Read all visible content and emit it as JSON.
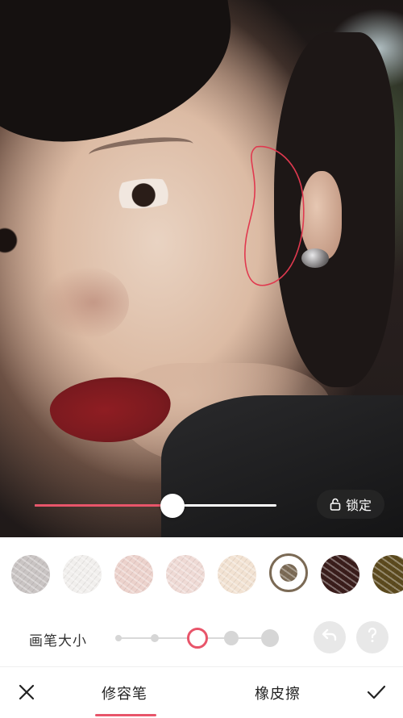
{
  "photo": {
    "lock_label": "锁定",
    "intensity_percent": 57
  },
  "swatches": [
    {
      "icon": "swatch-silver",
      "color": "#c9c4c3"
    },
    {
      "icon": "swatch-white",
      "color": "#f1efed"
    },
    {
      "icon": "swatch-pink",
      "color": "#ecd2cc"
    },
    {
      "icon": "swatch-blush",
      "color": "#efdad5"
    },
    {
      "icon": "swatch-champagne",
      "color": "#f2e2d2"
    },
    {
      "icon": "swatch-bronze",
      "color": "#7b6a55",
      "selected": true
    },
    {
      "icon": "swatch-dark-brown",
      "color": "#3a1d1b"
    },
    {
      "icon": "swatch-olive",
      "color": "#5c4a1e"
    }
  ],
  "brush": {
    "label": "画笔大小",
    "levels": 5,
    "selected_level": 3
  },
  "tabs": [
    {
      "label": "修容笔",
      "active": true
    },
    {
      "label": "橡皮擦",
      "active": false
    }
  ],
  "colors": {
    "accent": "#e8556a",
    "stroke": "#e0394f"
  },
  "icons": {
    "close": "close-icon",
    "confirm": "checkmark-icon",
    "undo": "undo-icon",
    "help": "help-icon",
    "lock": "lock-icon"
  }
}
